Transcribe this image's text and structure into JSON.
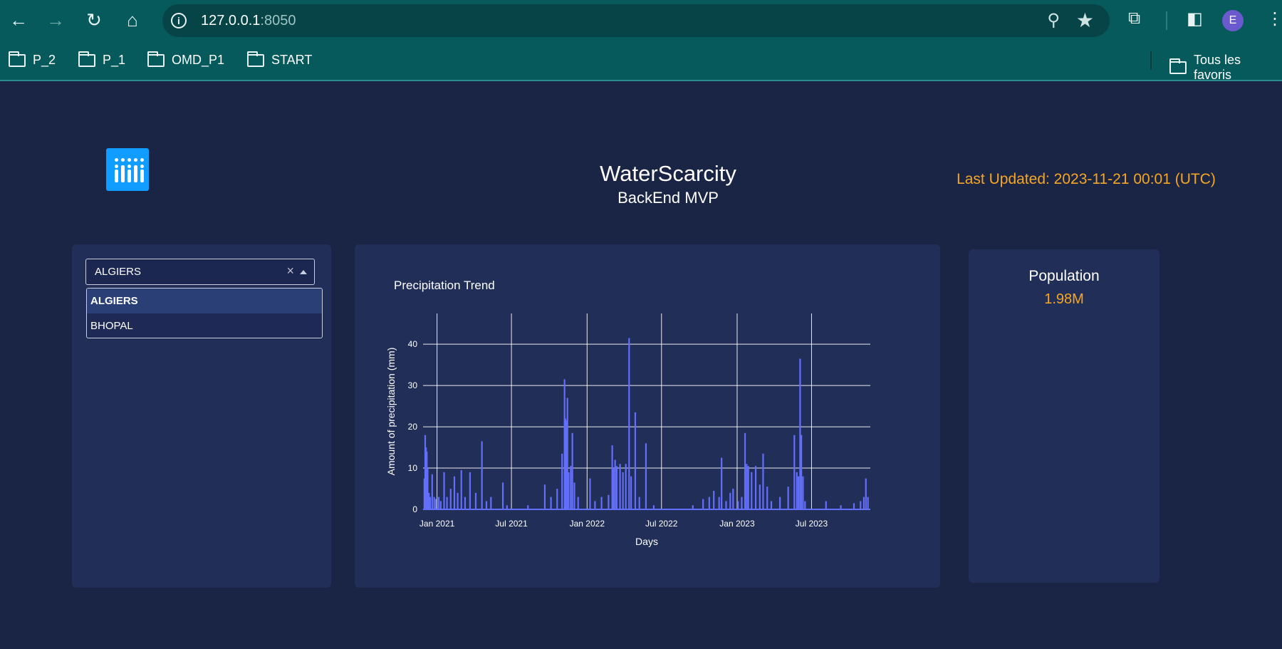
{
  "browser": {
    "url_host": "127.0.0.1",
    "url_port": ":8050",
    "profile_initial": "E",
    "bookmarks": [
      "P_2",
      "P_1",
      "OMD_P1",
      "START"
    ],
    "all_bookmarks_label": "Tous les favoris"
  },
  "header": {
    "title": "WaterScarcity",
    "subtitle": "BackEnd MVP",
    "last_updated": "Last Updated: 2023-11-21 00:01 (UTC)"
  },
  "city_selector": {
    "selected": "ALGIERS",
    "options": [
      "ALGIERS",
      "BHOPAL"
    ]
  },
  "population": {
    "label": "Population",
    "value": "1.98M"
  },
  "colors": {
    "accent": "#f5a623",
    "series": "#636efa",
    "background": "#1a2444",
    "card": "#212e58"
  },
  "chart_data": {
    "type": "bar",
    "title": "Precipitation Trend",
    "xlabel": "Days",
    "ylabel": "Amount of precipitation (mm)",
    "xlim": [
      "2020-11-28",
      "2023-11-21"
    ],
    "ylim": [
      0,
      44
    ],
    "x_ticks": [
      {
        "date": "2021-01-01",
        "label": "Jan 2021"
      },
      {
        "date": "2021-07-01",
        "label": "Jul 2021"
      },
      {
        "date": "2022-01-01",
        "label": "Jan 2022"
      },
      {
        "date": "2022-07-01",
        "label": "Jul 2022"
      },
      {
        "date": "2023-01-01",
        "label": "Jan 2023"
      },
      {
        "date": "2023-07-01",
        "label": "Jul 2023"
      }
    ],
    "y_ticks": [
      0,
      10,
      20,
      30,
      40
    ],
    "grid": true,
    "series": [
      {
        "values": [
          [
            "2020-12-01",
            7.5
          ],
          [
            "2020-12-03",
            18
          ],
          [
            "2020-12-05",
            15
          ],
          [
            "2020-12-07",
            14
          ],
          [
            "2020-12-09",
            10
          ],
          [
            "2020-12-12",
            4
          ],
          [
            "2020-12-15",
            3
          ],
          [
            "2020-12-20",
            8.5
          ],
          [
            "2020-12-25",
            3
          ],
          [
            "2020-12-29",
            2.5
          ],
          [
            "2021-01-05",
            3
          ],
          [
            "2021-01-10",
            2
          ],
          [
            "2021-01-18",
            9
          ],
          [
            "2021-01-25",
            3
          ],
          [
            "2021-02-03",
            5
          ],
          [
            "2021-02-12",
            8
          ],
          [
            "2021-02-20",
            4
          ],
          [
            "2021-03-01",
            9.5
          ],
          [
            "2021-03-10",
            3
          ],
          [
            "2021-03-22",
            9
          ],
          [
            "2021-04-05",
            4
          ],
          [
            "2021-04-20",
            16.5
          ],
          [
            "2021-05-01",
            2
          ],
          [
            "2021-05-12",
            3
          ],
          [
            "2021-06-10",
            6.5
          ],
          [
            "2021-06-20",
            1
          ],
          [
            "2021-08-10",
            1
          ],
          [
            "2021-09-20",
            6
          ],
          [
            "2021-10-05",
            3
          ],
          [
            "2021-10-20",
            5
          ],
          [
            "2021-11-01",
            13.5
          ],
          [
            "2021-11-07",
            31.5
          ],
          [
            "2021-11-09",
            22
          ],
          [
            "2021-11-12",
            21.5
          ],
          [
            "2021-11-14",
            27
          ],
          [
            "2021-11-17",
            9
          ],
          [
            "2021-11-22",
            10.5
          ],
          [
            "2021-11-26",
            18.5
          ],
          [
            "2021-12-01",
            6.5
          ],
          [
            "2021-12-10",
            3
          ],
          [
            "2022-01-08",
            7.5
          ],
          [
            "2022-01-20",
            2
          ],
          [
            "2022-02-05",
            3
          ],
          [
            "2022-02-22",
            3.5
          ],
          [
            "2022-03-03",
            15.5
          ],
          [
            "2022-03-06",
            10
          ],
          [
            "2022-03-10",
            12
          ],
          [
            "2022-03-14",
            10.5
          ],
          [
            "2022-03-22",
            11
          ],
          [
            "2022-03-29",
            9
          ],
          [
            "2022-04-05",
            11
          ],
          [
            "2022-04-13",
            41.5
          ],
          [
            "2022-04-18",
            8
          ],
          [
            "2022-04-28",
            23.5
          ],
          [
            "2022-05-08",
            3
          ],
          [
            "2022-05-24",
            16
          ],
          [
            "2022-06-12",
            1
          ],
          [
            "2022-09-15",
            1
          ],
          [
            "2022-10-10",
            2.5
          ],
          [
            "2022-10-25",
            3
          ],
          [
            "2022-11-05",
            4.5
          ],
          [
            "2022-11-18",
            3
          ],
          [
            "2022-11-24",
            12.5
          ],
          [
            "2022-12-05",
            2
          ],
          [
            "2022-12-15",
            4
          ],
          [
            "2022-12-22",
            5
          ],
          [
            "2023-01-03",
            2
          ],
          [
            "2023-01-12",
            3
          ],
          [
            "2023-01-20",
            18.5
          ],
          [
            "2023-01-24",
            11
          ],
          [
            "2023-01-28",
            10.5
          ],
          [
            "2023-02-05",
            9
          ],
          [
            "2023-02-15",
            10.5
          ],
          [
            "2023-02-25",
            6
          ],
          [
            "2023-03-05",
            13.5
          ],
          [
            "2023-03-15",
            5.5
          ],
          [
            "2023-03-25",
            2
          ],
          [
            "2023-04-15",
            3
          ],
          [
            "2023-05-05",
            5.5
          ],
          [
            "2023-05-20",
            18
          ],
          [
            "2023-05-26",
            9
          ],
          [
            "2023-05-30",
            8
          ],
          [
            "2023-06-03",
            36.5
          ],
          [
            "2023-06-06",
            18
          ],
          [
            "2023-06-10",
            8
          ],
          [
            "2023-06-15",
            2
          ],
          [
            "2023-08-05",
            2
          ],
          [
            "2023-09-10",
            1
          ],
          [
            "2023-10-12",
            1.5
          ],
          [
            "2023-10-28",
            2
          ],
          [
            "2023-11-05",
            3
          ],
          [
            "2023-11-10",
            7.5
          ],
          [
            "2023-11-15",
            3
          ]
        ]
      }
    ]
  }
}
